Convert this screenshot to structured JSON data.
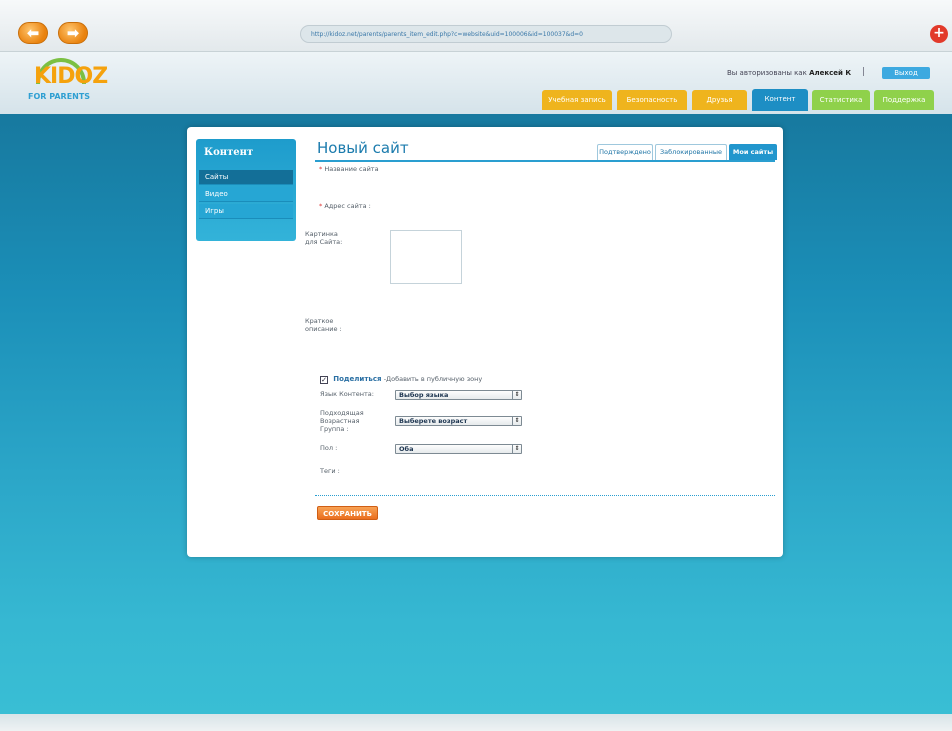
{
  "browser": {
    "url": "http://kidoz.net/parents/parents_item_edit.php?c=website&uid=100006&id=100037&d=0",
    "back_icon": "⬅",
    "forward_icon": "➡",
    "close_icon": "+"
  },
  "logo": {
    "main": "KIDOZ",
    "sub": "FOR PARENTS"
  },
  "header": {
    "auth_prefix": "Вы авторизованы как",
    "user_name": "Алексей К",
    "separator": "|",
    "logout": "Выход"
  },
  "top_tabs": {
    "diary": "Учебная запись",
    "security": "Безопасность",
    "friends": "Друзья",
    "content": "Контент",
    "stats": "Статистика",
    "support": "Поддержка"
  },
  "sidebar": {
    "title": "Контент",
    "items": [
      "Сайты",
      "Видео",
      "Игры"
    ]
  },
  "page": {
    "title": "Новый сайт",
    "subtabs": {
      "confirmed": "Подтверждено",
      "blocked": "Заблокированные",
      "mine": "Мои сайты"
    }
  },
  "form": {
    "required_mark": "*",
    "name_label": "Название сайта",
    "address_label": "Адрес сайта :",
    "picture_label": "Картинка для Сайта:",
    "description_label": "Краткое описание :",
    "share_check": "✓",
    "share_label": "Поделиться",
    "share_note": "-Добавить в публичную зону",
    "language_label": "Язык Контента:",
    "language_value": "Выбор языка",
    "age_label": "Подходящая Возрастная Группа :",
    "age_value": "Выберете возраст",
    "gender_label": "Пол :",
    "gender_value": "Оба",
    "tags_label": "Теги :",
    "select_arrow": "⇕",
    "save_button": "СОХРАНИТЬ"
  },
  "colors": {
    "accent": "#1d8ec4",
    "tab_orange": "#efb41d",
    "tab_green": "#8fd14b",
    "save_orange": "#ea6f1f",
    "background_teal": "#1b8fb8"
  }
}
